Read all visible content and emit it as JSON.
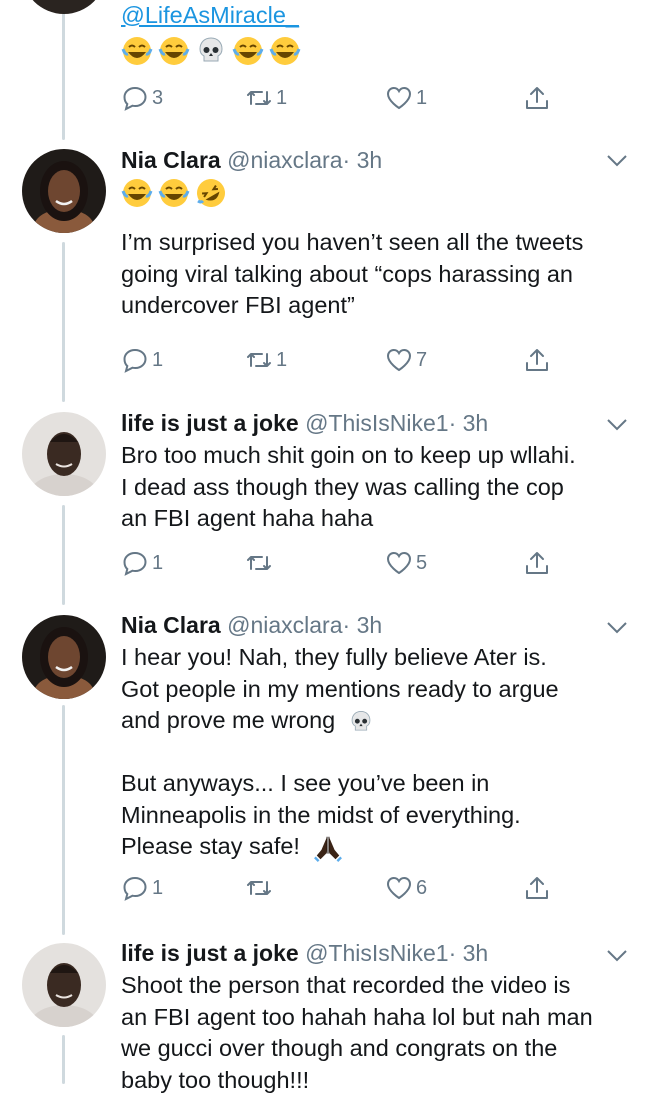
{
  "colors": {
    "text": "#14171a",
    "secondary": "#657786",
    "link": "#1b95e0",
    "thread_line": "#cfd9de"
  },
  "top_partial": {
    "mention": "@LifeAsMiracle_",
    "emojis": [
      "face-with-tears-of-joy",
      "face-with-tears-of-joy",
      "skull",
      "face-with-tears-of-joy",
      "face-with-tears-of-joy"
    ],
    "actions": {
      "replies": "3",
      "retweets": "1",
      "likes": "1"
    }
  },
  "tweets": [
    {
      "name": "Nia Clara",
      "handle": "@niaxclara",
      "time": "· 3h",
      "emojis": [
        "face-with-tears-of-joy",
        "face-with-tears-of-joy",
        "rolling-on-floor-laughing"
      ],
      "lines": [
        "I’m surprised you haven’t seen all the tweets",
        "going viral talking about “cops harassing an",
        "undercover FBI agent”"
      ],
      "actions": {
        "replies": "1",
        "retweets": "1",
        "likes": "7"
      }
    },
    {
      "name": "life is just a joke",
      "handle": "@ThisIsNike1",
      "time": "· 3h",
      "lines": [
        "Bro too much shit goin on to keep up wllahi.",
        "I dead ass though they was calling the cop",
        "an FBI agent haha haha"
      ],
      "actions": {
        "replies": "1",
        "retweets": "",
        "likes": "5"
      }
    },
    {
      "name": "Nia Clara",
      "handle": "@niaxclara",
      "time": "· 3h",
      "lines": [
        "I hear you! Nah, they fully believe Ater is.",
        "Got people in my mentions ready to argue",
        "and prove me wrong",
        "",
        "But anyways... I see you’ve been in",
        "Minneapolis in the midst of everything.",
        "Please stay safe!"
      ],
      "line_emojis": {
        "2": "skull",
        "6": "folded-hands"
      },
      "actions": {
        "replies": "1",
        "retweets": "",
        "likes": "6"
      }
    },
    {
      "name": "life is just a joke",
      "handle": "@ThisIsNike1",
      "time": "· 3h",
      "lines": [
        "Shoot the person that recorded the video is",
        "an FBI agent too hahah haha lol but nah man",
        "we gucci over though and congrats on the",
        "baby too though!!!"
      ]
    }
  ]
}
